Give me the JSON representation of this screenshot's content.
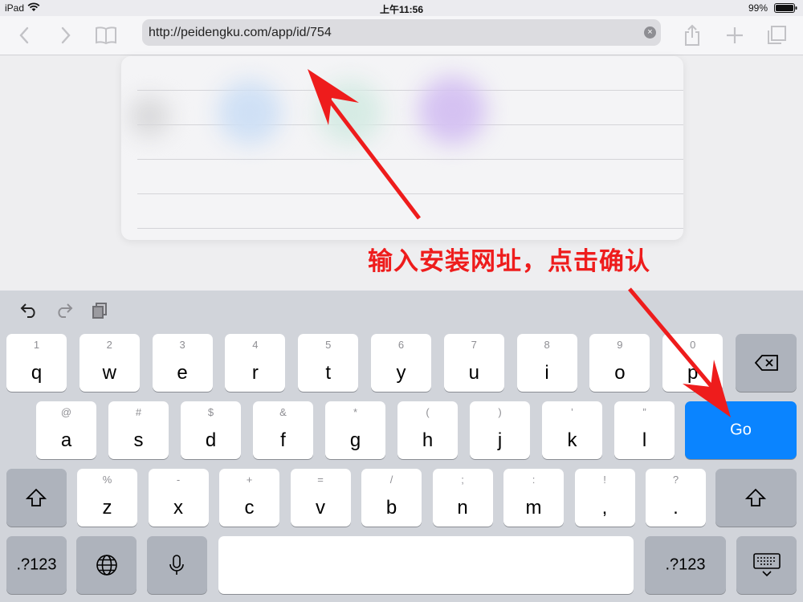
{
  "status": {
    "device": "iPad",
    "time": "上午11:56",
    "battery": "99%"
  },
  "browser": {
    "url": "http://peidengku.com/app/id/754",
    "clear_glyph": "×"
  },
  "annotation": {
    "text": "输入安装网址，点击确认",
    "color": "#ee1c1c"
  },
  "keyboard": {
    "row1": [
      {
        "sub": "1",
        "main": "q"
      },
      {
        "sub": "2",
        "main": "w"
      },
      {
        "sub": "3",
        "main": "e"
      },
      {
        "sub": "4",
        "main": "r"
      },
      {
        "sub": "5",
        "main": "t"
      },
      {
        "sub": "6",
        "main": "y"
      },
      {
        "sub": "7",
        "main": "u"
      },
      {
        "sub": "8",
        "main": "i"
      },
      {
        "sub": "9",
        "main": "o"
      },
      {
        "sub": "0",
        "main": "p"
      }
    ],
    "row2": [
      {
        "sub": "@",
        "main": "a"
      },
      {
        "sub": "#",
        "main": "s"
      },
      {
        "sub": "$",
        "main": "d"
      },
      {
        "sub": "&",
        "main": "f"
      },
      {
        "sub": "*",
        "main": "g"
      },
      {
        "sub": "(",
        "main": "h"
      },
      {
        "sub": ")",
        "main": "j"
      },
      {
        "sub": "’",
        "main": "k"
      },
      {
        "sub": "”",
        "main": "l"
      }
    ],
    "row3": [
      {
        "sub": "%",
        "main": "z"
      },
      {
        "sub": "-",
        "main": "x"
      },
      {
        "sub": "+",
        "main": "c"
      },
      {
        "sub": "=",
        "main": "v"
      },
      {
        "sub": "/",
        "main": "b"
      },
      {
        "sub": ";",
        "main": "n"
      },
      {
        "sub": ":",
        "main": "m"
      },
      {
        "sub": "!",
        "main": ","
      },
      {
        "sub": "?",
        "main": "."
      }
    ],
    "go_label": "Go",
    "numbers_label": ".?123"
  },
  "colors": {
    "accent": "#0a84ff",
    "keyboard_bg": "#d1d4da",
    "dark_key": "#aeb3bc"
  }
}
